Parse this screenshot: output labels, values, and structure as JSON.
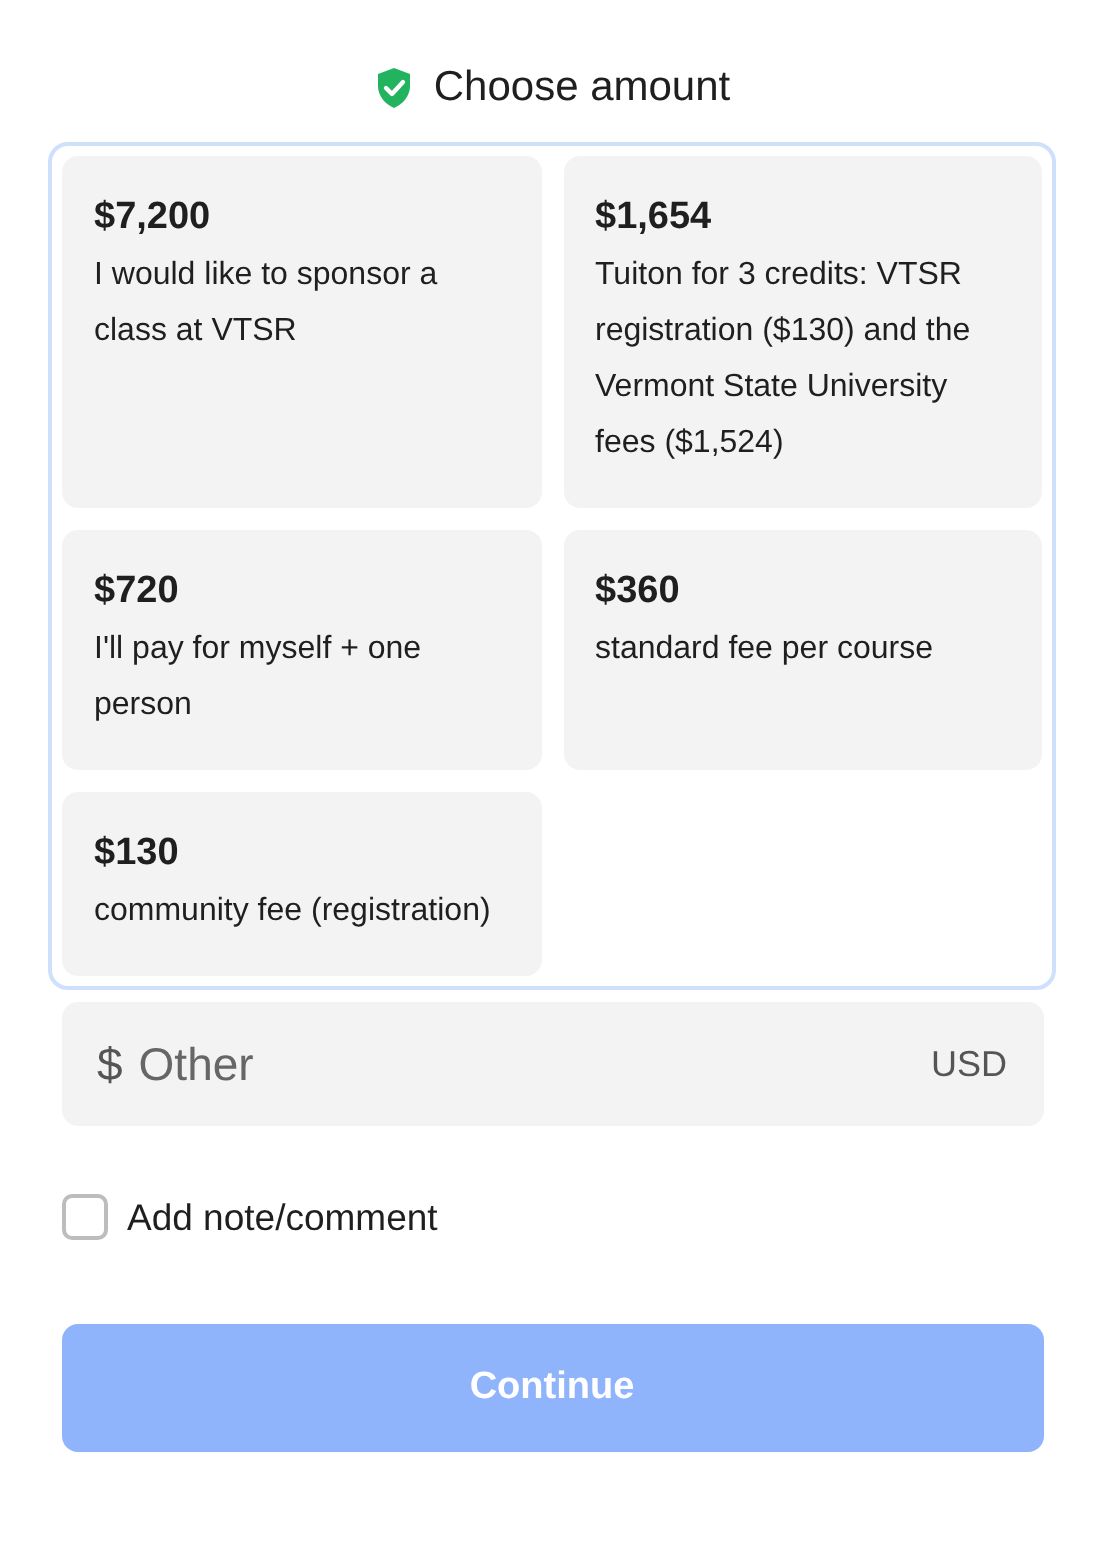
{
  "title": "Choose amount",
  "amounts": [
    {
      "amount": "$7,200",
      "description": "I would like to sponsor a class at VTSR",
      "selected": false
    },
    {
      "amount": "$1,654",
      "description": "Tuiton for 3 credits: VTSR registration ($130) and the Vermont State University fees ($1,524)",
      "selected": false
    },
    {
      "amount": "$720",
      "description": "I'll pay for myself + one person",
      "selected": false
    },
    {
      "amount": "$360",
      "description": "standard fee per course",
      "selected": false
    },
    {
      "amount": "$130",
      "description": "community fee (registration)",
      "selected": false
    }
  ],
  "other": {
    "currency_symbol": "$",
    "placeholder": "Other",
    "currency": "USD"
  },
  "note": {
    "label": "Add note/comment",
    "checked": false
  },
  "continue": {
    "label": "Continue",
    "disabled": true
  }
}
